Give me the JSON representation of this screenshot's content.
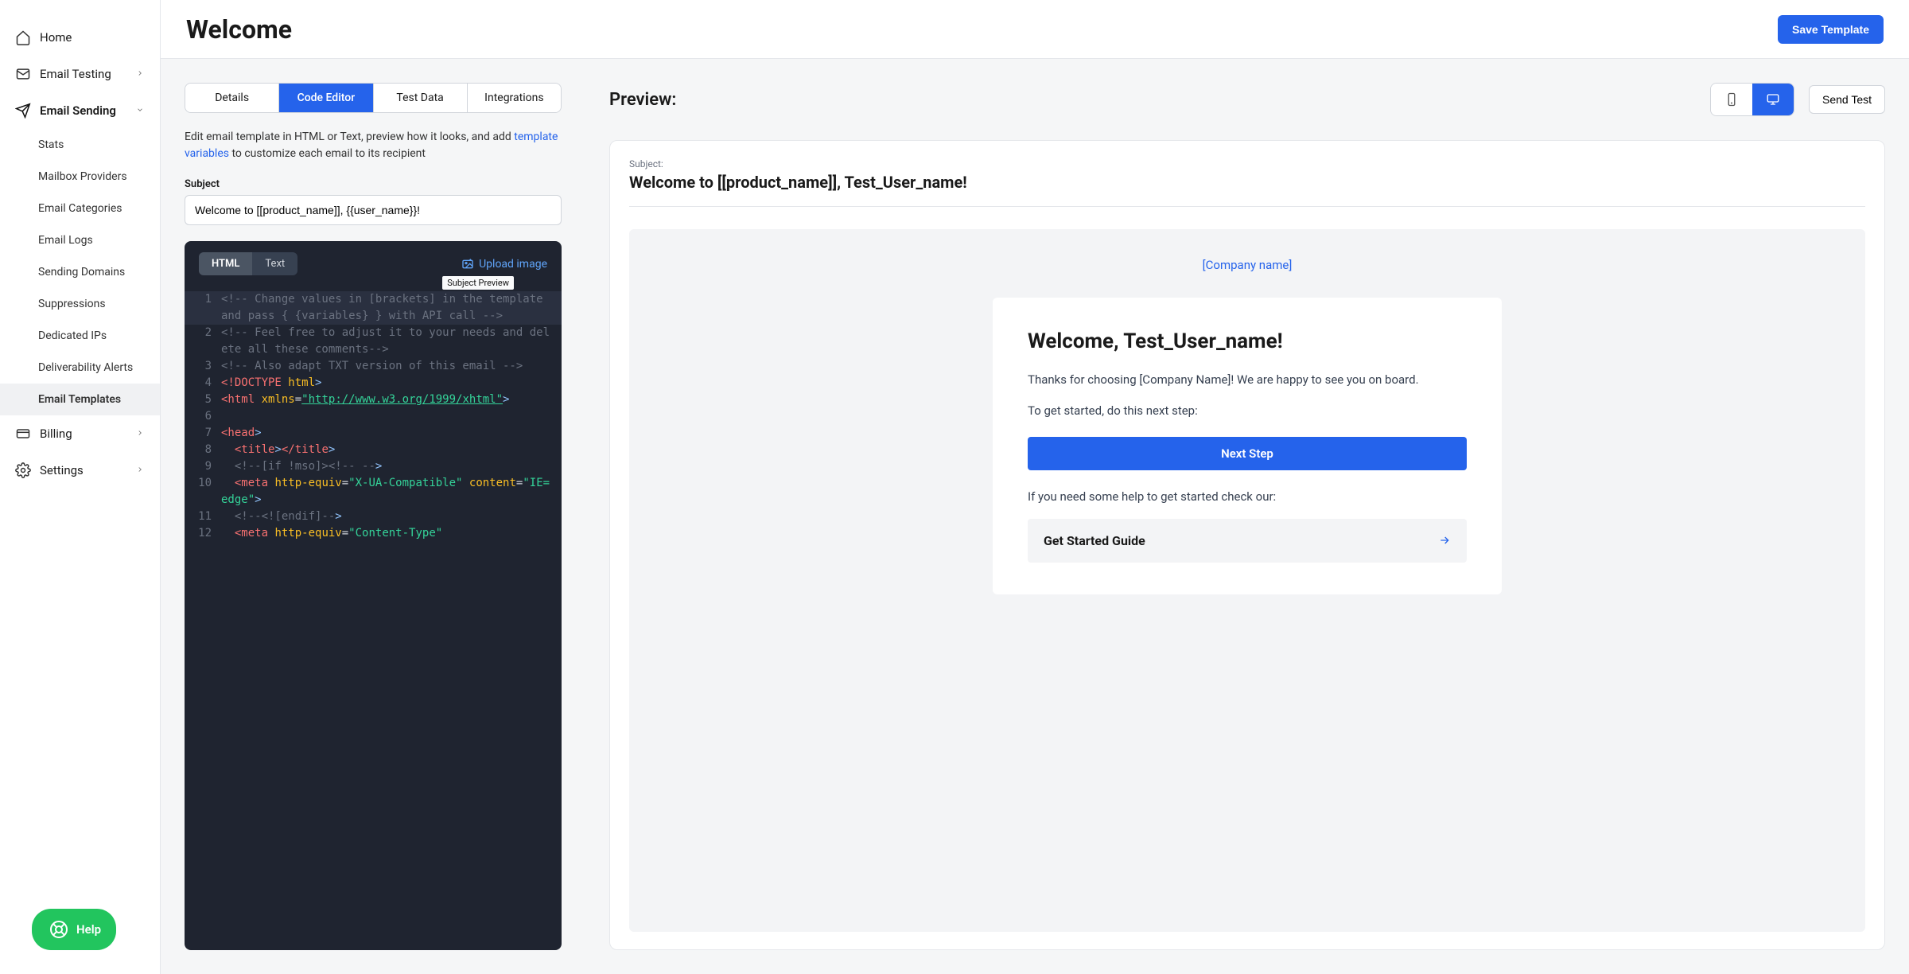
{
  "sidebar": {
    "home": "Home",
    "emailTesting": "Email Testing",
    "emailSending": "Email Sending",
    "subs": [
      "Stats",
      "Mailbox Providers",
      "Email Categories",
      "Email Logs",
      "Sending Domains",
      "Suppressions",
      "Dedicated IPs",
      "Deliverability Alerts",
      "Email Templates"
    ],
    "billing": "Billing",
    "settings": "Settings",
    "help": "Help"
  },
  "header": {
    "title": "Welcome",
    "saveBtn": "Save Template"
  },
  "tabs": {
    "t1": "Details",
    "t2": "Code Editor",
    "t3": "Test Data",
    "t4": "Integrations"
  },
  "editNote": {
    "part1": "Edit email template in HTML or Text, preview how it looks, and add ",
    "link": "template variables",
    "part2": " to customize each email to its recipient"
  },
  "subject": {
    "label": "Subject",
    "value": "Welcome to [[product_name]], {{user_name}}!"
  },
  "codeEditor": {
    "htmlBtn": "HTML",
    "textBtn": "Text",
    "upload": "Upload image",
    "tooltip": "Subject Preview",
    "lines": {
      "l1": "<!-- Change values in [brackets] in the template and pass { {variables} } with API call -->",
      "l2": "<!-- Feel free to adjust it to your needs and delete all these comments-->",
      "l3": "<!-- Also adapt TXT version of this email -->",
      "l4a": "<!DOCTYPE",
      "l4b": " html",
      "l4c": ">",
      "l5a": "<html",
      "l5b": " xmlns",
      "l5c": "=",
      "l5d": "\"http://www.w3.org/1999/xhtml\"",
      "l5e": ">",
      "l7a": "<head",
      "l7b": ">",
      "l8a": "<title",
      "l8b": ">",
      "l8c": "</title",
      "l8d": ">",
      "l9a": "<!--",
      "l9b": "[if !mso]>",
      "l9c": "<!--",
      "l9d": " --",
      "l9e": ">",
      "l10a": "<meta",
      "l10b": " http-equiv",
      "l10c": "=",
      "l10d": "\"X-UA-Compatible\"",
      "l10e": " content",
      "l10f": "=",
      "l10g": "\"IE=edge\"",
      "l10h": ">",
      "l11a": "<!--",
      "l11b": "<![endif]--",
      "l11c": ">",
      "l12a": "<meta",
      "l12b": " http-equiv",
      "l12c": "=",
      "l12d": "\"Content-Type\""
    }
  },
  "preview": {
    "title": "Preview:",
    "sendTest": "Send Test",
    "subjectLabel": "Subject:",
    "subject": "Welcome to [[product_name]], Test_User_name!",
    "brand": "[Company name]",
    "heading": "Welcome, Test_User_name!",
    "p1": "Thanks for choosing [Company Name]! We are happy to see you on board.",
    "p2": "To get started, do this next step:",
    "cta": "Next Step",
    "p3": "If you need some help to get started check our:",
    "action": "Get Started Guide"
  }
}
